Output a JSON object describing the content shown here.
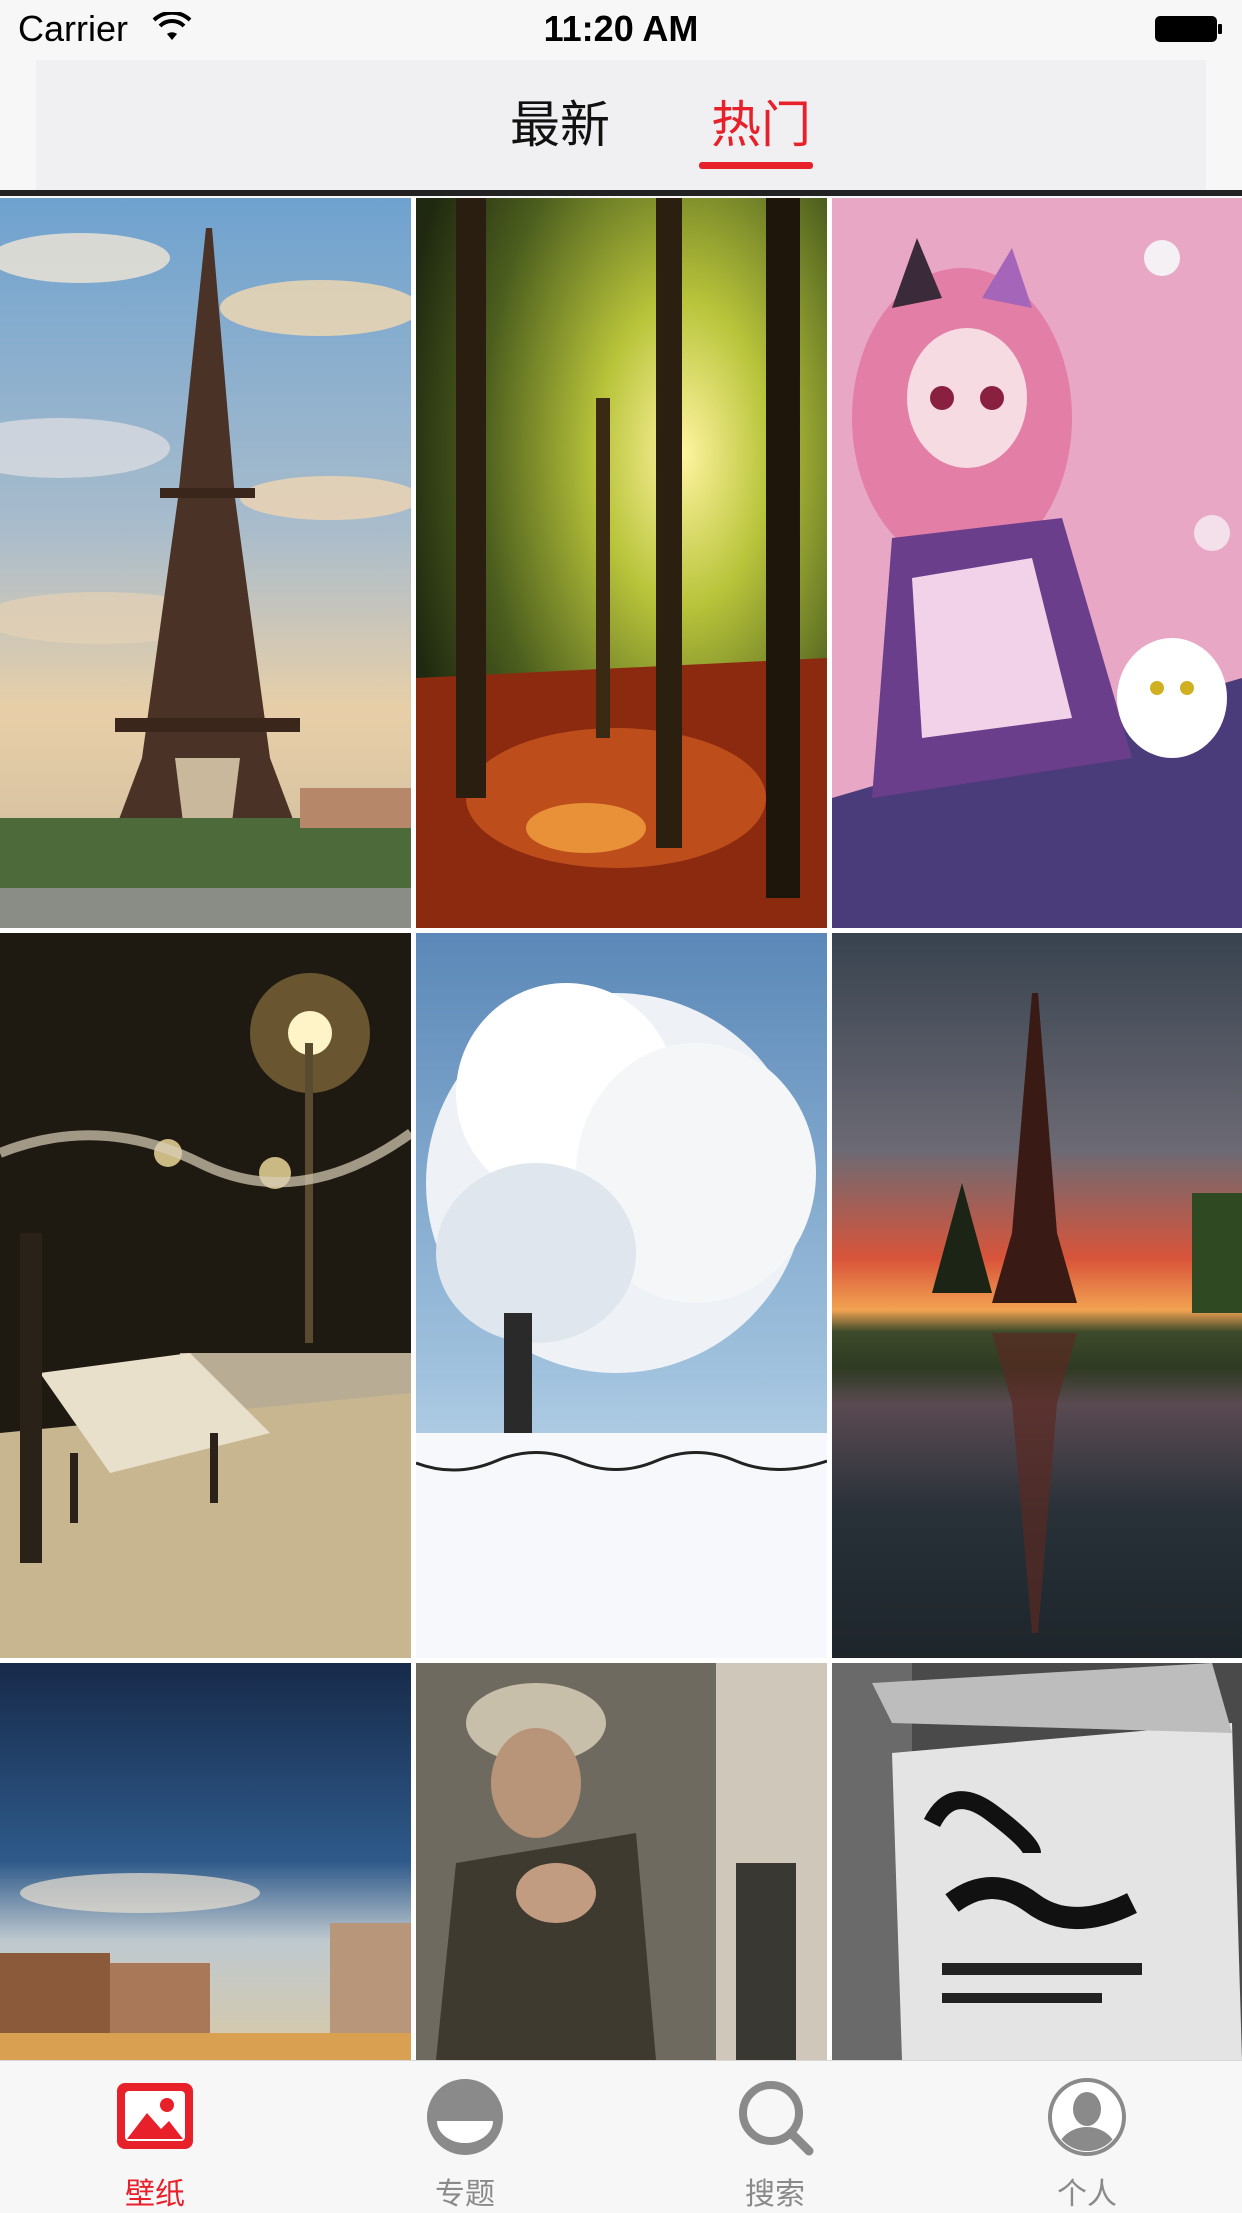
{
  "status_bar": {
    "carrier": "Carrier",
    "time": "11:20 AM"
  },
  "header": {
    "tabs": [
      {
        "label": "最新",
        "selected": false
      },
      {
        "label": "热门",
        "selected": true
      }
    ],
    "accent": "#e8202a"
  },
  "grid": {
    "columns": 3,
    "items": [
      {
        "subject": "eiffel-tower-day"
      },
      {
        "subject": "autumn-forest-path"
      },
      {
        "subject": "anime-girl-pink"
      },
      {
        "subject": "snowy-bench-night"
      },
      {
        "subject": "frosted-tree"
      },
      {
        "subject": "eiffel-tower-sunset-reflection"
      },
      {
        "subject": "venice-dusk"
      },
      {
        "subject": "soldier-woman"
      },
      {
        "subject": "sound-of-music-poster"
      }
    ]
  },
  "tab_bar": {
    "items": [
      {
        "label": "壁纸",
        "icon": "image-icon",
        "active": true
      },
      {
        "label": "专题",
        "icon": "topic-icon",
        "active": false
      },
      {
        "label": "搜索",
        "icon": "search-icon",
        "active": false
      },
      {
        "label": "个人",
        "icon": "person-icon",
        "active": false
      }
    ]
  }
}
